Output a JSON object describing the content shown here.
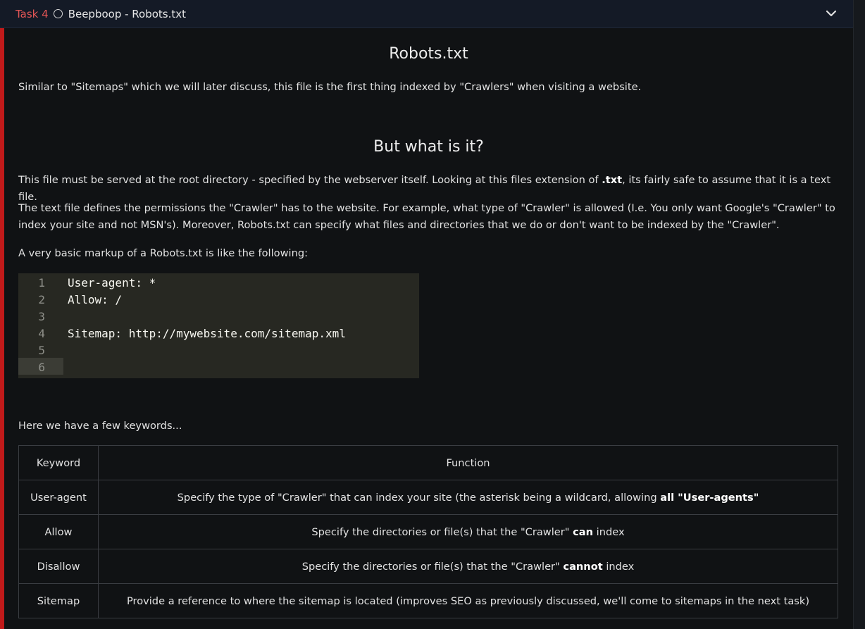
{
  "task": {
    "label": "Task 4",
    "title": "Beepboop - Robots.txt"
  },
  "section1": {
    "heading": "Robots.txt",
    "intro": "Similar to \"Sitemaps\" which we will later discuss, this file is the first thing indexed by \"Crawlers\" when visiting a website."
  },
  "section2": {
    "heading": "But what is it?",
    "p1_before": "This file must be served at the root directory - specified by the webserver itself. Looking at this files extension of ",
    "p1_bold": ".txt",
    "p1_after": ", its fairly safe to assume that it is a text file.",
    "p2": "The text file defines the permissions the \"Crawler\" has to the website. For example, what type of \"Crawler\" is allowed (I.e. You only want Google's \"Crawler\" to index your site and not MSN's). Moreover, Robots.txt can specify what files and directories that we do or don't want to be indexed by the \"Crawler\".",
    "p3": "A very basic markup of a Robots.txt is like the following:"
  },
  "code": {
    "line_numbers": [
      "1",
      "2",
      "3",
      "4",
      "5",
      "6"
    ],
    "lines": [
      "User-agent: *",
      "Allow: /",
      "",
      "Sitemap: http://mywebsite.com/sitemap.xml",
      "",
      ""
    ]
  },
  "keywords_intro": "Here we have a few keywords...",
  "table": {
    "headers": [
      "Keyword",
      "Function"
    ],
    "rows": [
      {
        "keyword": "User-agent",
        "before": "Specify the type of \"Crawler\" that can index your site (the asterisk being a wildcard, allowing ",
        "bold": "all \"User-agents\"",
        "after": ""
      },
      {
        "keyword": "Allow",
        "before": "Specify the directories or file(s) that the \"Crawler\" ",
        "bold": "can",
        "after": " index"
      },
      {
        "keyword": "Disallow",
        "before": "Specify the directories or file(s) that the \"Crawler\" ",
        "bold": "cannot",
        "after": " index"
      },
      {
        "keyword": "Sitemap",
        "before": "Provide a reference to where the sitemap is located (improves SEO as previously discussed, we'll come to sitemaps in the next task)",
        "bold": "",
        "after": ""
      }
    ]
  },
  "colors": {
    "task_label": "#e25555",
    "accent_bar": "#c11a1a",
    "background": "#101214",
    "header_bg": "#141a26",
    "code_bg": "#272822"
  },
  "icons": {
    "status": "circle-outline-icon",
    "expand": "chevron-down-icon"
  }
}
